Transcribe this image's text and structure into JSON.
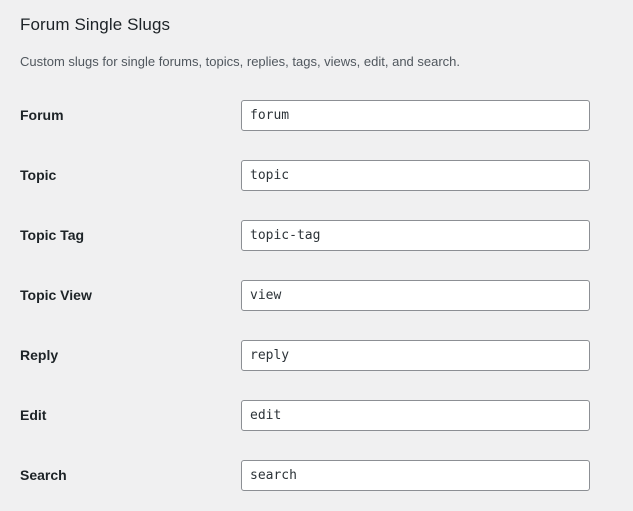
{
  "panel": {
    "title": "Forum Single Slugs",
    "description": "Custom slugs for single forums, topics, replies, tags, views, edit, and search."
  },
  "colors": {
    "background": "#f0f0f1",
    "label_text": "#1d2327",
    "description_text": "#50575e",
    "input_border": "#8c8f94",
    "input_background": "#ffffff",
    "input_text": "#2c3338"
  },
  "fields": [
    {
      "label": "Forum",
      "value": "forum",
      "placeholder": "forum"
    },
    {
      "label": "Topic",
      "value": "topic",
      "placeholder": "topic"
    },
    {
      "label": "Topic Tag",
      "value": "topic-tag",
      "placeholder": "topic-tag"
    },
    {
      "label": "Topic View",
      "value": "view",
      "placeholder": "view"
    },
    {
      "label": "Reply",
      "value": "reply",
      "placeholder": "reply"
    },
    {
      "label": "Edit",
      "value": "edit",
      "placeholder": "edit"
    },
    {
      "label": "Search",
      "value": "search",
      "placeholder": "search"
    }
  ]
}
